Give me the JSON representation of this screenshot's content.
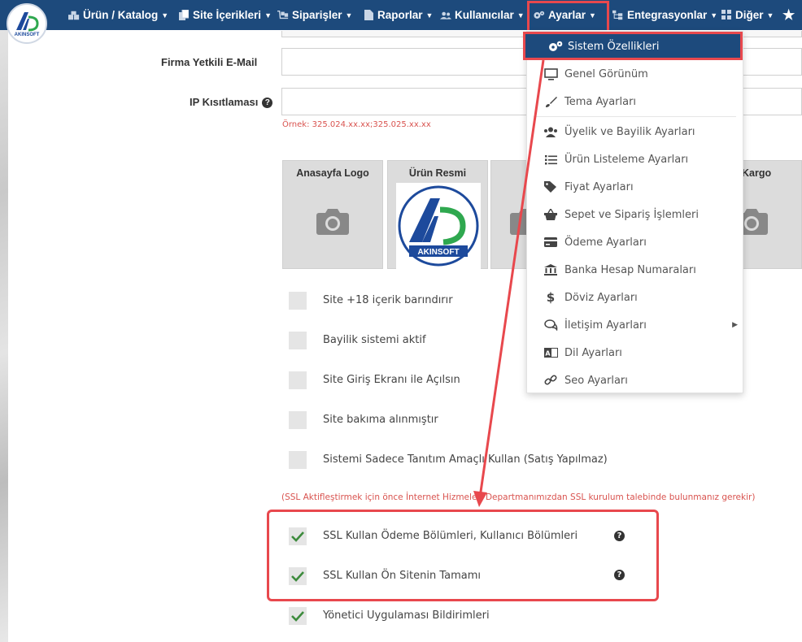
{
  "brand": {
    "logo_text": "AKINSOFT"
  },
  "nav": {
    "items": [
      {
        "label": "Ürün / Katalog",
        "icon": "boxes-icon"
      },
      {
        "label": "Site İçerikleri",
        "icon": "copy-icon"
      },
      {
        "label": "Siparişler",
        "icon": "dolly-icon"
      },
      {
        "label": "Raporlar",
        "icon": "file-icon"
      },
      {
        "label": "Kullanıcılar",
        "icon": "users-icon"
      },
      {
        "label": "Ayarlar",
        "icon": "gears-icon"
      },
      {
        "label": "Entegrasyonlar",
        "icon": "sitemap-icon"
      },
      {
        "label": "Diğer",
        "icon": "grid-icon"
      }
    ],
    "star_icon": "star-icon"
  },
  "form": {
    "email_label": "Firma Yetkili E-Mail",
    "ip_label": "IP Kısıtlaması",
    "ip_hint": "Örnek: 325.024.xx.xx;325.025.xx.xx",
    "images": [
      {
        "title": "Anasayfa Logo"
      },
      {
        "title": "Ürün Resmi"
      },
      {
        "title": ""
      },
      {
        "title": "Kargo"
      }
    ],
    "checks": [
      {
        "label": "Site +18 içerik barındırır",
        "checked": false
      },
      {
        "label": "Bayilik sistemi aktif",
        "checked": false
      },
      {
        "label": "Site Giriş Ekranı ile Açılsın",
        "checked": false
      },
      {
        "label": "Site bakıma alınmıştır",
        "checked": false
      },
      {
        "label": "Sistemi Sadece Tanıtım Amaçlı Kullan (Satış Yapılmaz)",
        "checked": false
      }
    ],
    "ssl_note": "(SSL Aktifleştirmek için önce İnternet Hizmeleri Departmanımızdan SSL kurulum talebinde bulunmanız gerekir)",
    "ssl_checks": [
      {
        "label": "SSL Kullan Ödeme Bölümleri, Kullanıcı Bölümleri",
        "checked": true
      },
      {
        "label": "SSL Kullan Ön Sitenin Tamamı",
        "checked": true
      }
    ],
    "admin_check": {
      "label": "Yönetici Uygulaması Bildirimleri",
      "checked": true
    }
  },
  "dropdown": {
    "selected": "Sistem Özellikleri",
    "items": [
      {
        "label": "Genel Görünüm",
        "icon": "monitor-icon"
      },
      {
        "label": "Tema Ayarları",
        "icon": "brush-icon"
      },
      {
        "label": "Üyelik ve Bayilik Ayarları",
        "icon": "users-icon"
      },
      {
        "label": "Ürün Listeleme Ayarları",
        "icon": "list-icon"
      },
      {
        "label": "Fiyat Ayarları",
        "icon": "tags-icon"
      },
      {
        "label": "Sepet ve Sipariş İşlemleri",
        "icon": "basket-icon"
      },
      {
        "label": "Ödeme Ayarları",
        "icon": "credit-card-icon"
      },
      {
        "label": "Banka Hesap Numaraları",
        "icon": "bank-icon"
      },
      {
        "label": "Döviz Ayarları",
        "icon": "dollar-icon"
      },
      {
        "label": "İletişim Ayarları",
        "icon": "comments-icon"
      },
      {
        "label": "Dil Ayarları",
        "icon": "language-icon"
      },
      {
        "label": "Seo Ayarları",
        "icon": "link-icon"
      }
    ]
  },
  "colors": {
    "nav_bg": "#1d4a7c",
    "highlight": "#e8484d",
    "hint": "#d9534f",
    "check": "#3d8b3d"
  }
}
